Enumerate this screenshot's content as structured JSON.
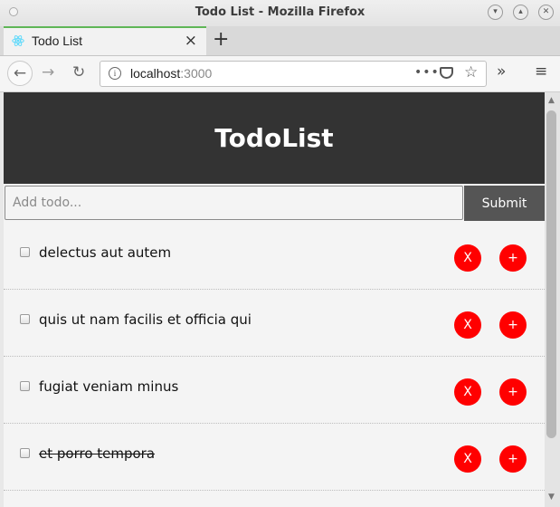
{
  "window": {
    "title": "Todo List - Mozilla Firefox",
    "minimize_icon": "chevron-down-icon",
    "maximize_icon": "chevron-up-icon",
    "close_icon": "close-icon"
  },
  "tab": {
    "title": "Todo List",
    "close_glyph": "×",
    "new_tab_glyph": "+"
  },
  "nav": {
    "back_glyph": "←",
    "forward_glyph": "→",
    "reload_glyph": "↻",
    "url_host": "localhost",
    "url_port": ":3000",
    "page_actions": "•••",
    "star_glyph": "☆",
    "overflow_glyph": "»",
    "menu_glyph": "≡",
    "info_glyph": "i"
  },
  "app": {
    "header_title": "TodoList",
    "input_placeholder": "Add todo...",
    "input_value": "",
    "submit_label": "Submit",
    "todos": [
      {
        "title": "delectus aut autem",
        "completed": false
      },
      {
        "title": "quis ut nam facilis et officia qui",
        "completed": false
      },
      {
        "title": "fugiat veniam minus",
        "completed": false
      },
      {
        "title": "et porro tempora",
        "completed": true
      }
    ],
    "delete_label": "X",
    "add_label": "+"
  },
  "colors": {
    "header_bg": "#333333",
    "button_red": "#ff0000",
    "submit_bg": "#555555",
    "tab_accent": "#5fb657"
  }
}
